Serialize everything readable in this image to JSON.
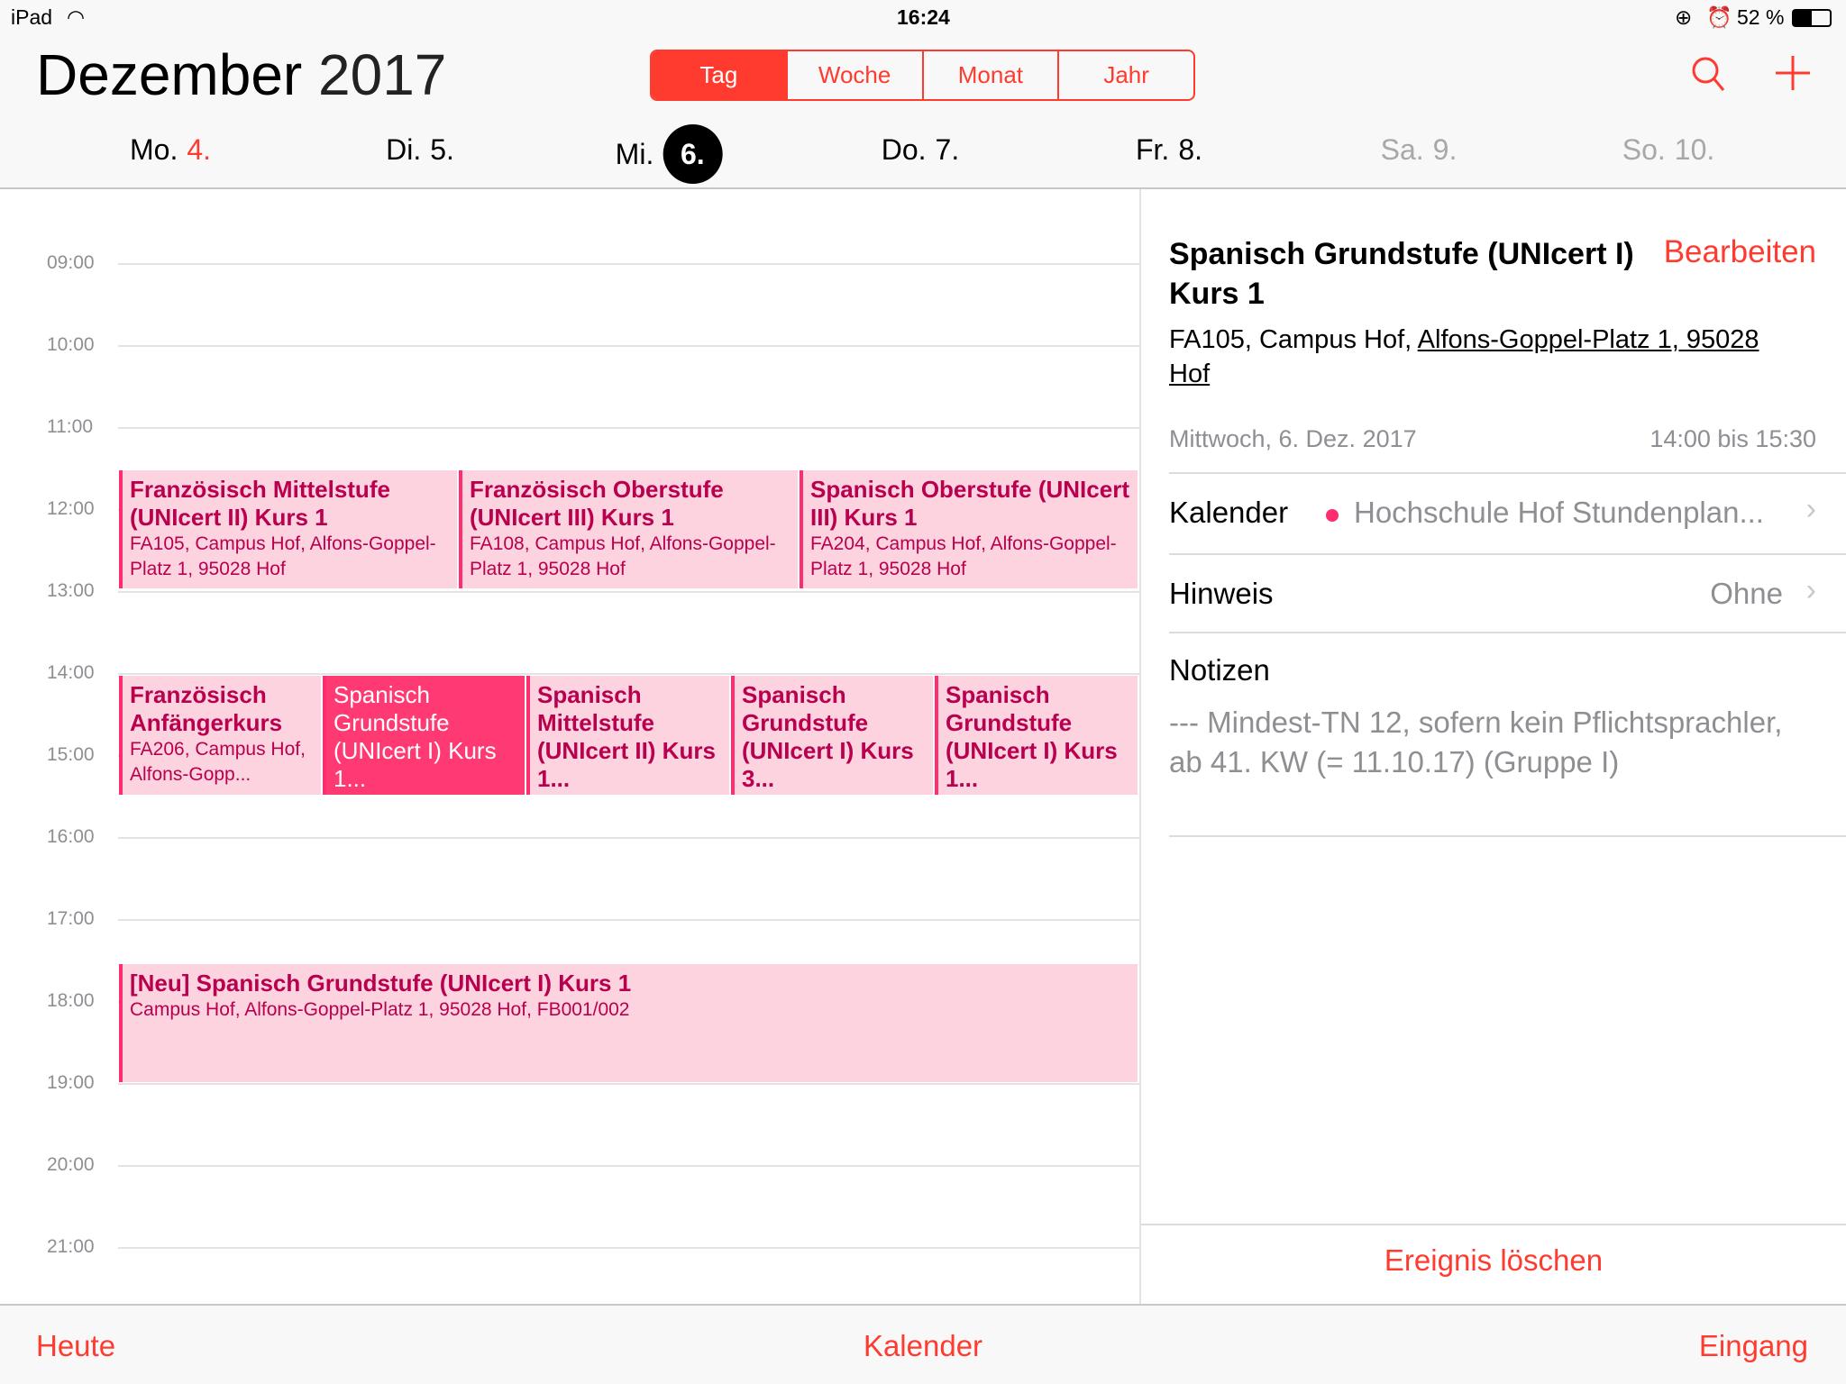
{
  "status": {
    "device": "iPad",
    "time": "16:24",
    "battery": "52 %",
    "battery_level": 52
  },
  "header": {
    "month": "Dezember",
    "year": "2017",
    "views": [
      "Tag",
      "Woche",
      "Monat",
      "Jahr"
    ],
    "selected_view": "Tag",
    "search_icon": "search-icon",
    "add_icon": "plus-icon"
  },
  "days": [
    {
      "wd": "Mo.",
      "d": "4."
    },
    {
      "wd": "Di.",
      "d": "5."
    },
    {
      "wd": "Mi.",
      "d": "6."
    },
    {
      "wd": "Do.",
      "d": "7."
    },
    {
      "wd": "Fr.",
      "d": "8."
    },
    {
      "wd": "Sa.",
      "d": "9."
    },
    {
      "wd": "So.",
      "d": "10."
    }
  ],
  "hours": [
    "09:00",
    "10:00",
    "11:00",
    "12:00",
    "13:00",
    "14:00",
    "15:00",
    "16:00",
    "17:00",
    "18:00",
    "19:00",
    "20:00",
    "21:00"
  ],
  "events": [
    {
      "title": "Französisch Mittelstufe (UNIcert II) Kurs 1",
      "loc": "FA105, Campus Hof, Alfons-Goppel-Platz 1, 95028 Hof"
    },
    {
      "title": "Französisch Oberstufe (UNIcert III) Kurs 1",
      "loc": "FA108, Campus Hof, Alfons-Goppel-Platz 1, 95028 Hof"
    },
    {
      "title": "Spanisch Oberstufe (UNIcert III) Kurs 1",
      "loc": "FA204, Campus Hof, Alfons-Goppel-Platz 1, 95028 Hof"
    },
    {
      "title": "Französisch Anfängerkurs",
      "loc": "FA206, Campus Hof, Alfons-Gopp..."
    },
    {
      "title": "Spanisch Grundstufe (UNIcert I) Kurs 1...",
      "loc": ""
    },
    {
      "title": "Spanisch Mittelstufe (UNIcert II) Kurs 1...",
      "loc": ""
    },
    {
      "title": "Spanisch Grundstufe (UNIcert I) Kurs 3...",
      "loc": ""
    },
    {
      "title": "Spanisch Grundstufe (UNIcert I) Kurs 1...",
      "loc": ""
    },
    {
      "title": "[Neu] Spanisch Grundstufe (UNIcert I) Kurs 1",
      "loc": "Campus Hof, Alfons-Goppel-Platz 1, 95028 Hof, FB001/002"
    }
  ],
  "detail": {
    "title": "Spanisch Grundstufe (UNIcert I) Kurs 1",
    "edit": "Bearbeiten",
    "location_prefix": "FA105, Campus Hof, ",
    "location_link": "Alfons-Goppel-Platz 1, 95028 Hof",
    "date": "Mittwoch, 6. Dez. 2017",
    "time": "14:00 bis 15:30",
    "calendar_label": "Kalender",
    "calendar_value": "Hochschule Hof Stundenplan...",
    "calendar_color": "#ff2d6f",
    "alert_label": "Hinweis",
    "alert_value": "Ohne",
    "notes_label": "Notizen",
    "notes": "---  Mindest-TN 12, sofern kein Pflichtsprachler, ab 41. KW (= 11.10.17) (Gruppe I)",
    "delete": "Ereignis löschen"
  },
  "toolbar": {
    "today": "Heute",
    "calendars": "Kalender",
    "inbox": "Eingang"
  },
  "colors": {
    "accent": "#ff3b30",
    "event_bg": "#fdd3df",
    "event_text": "#b8004e",
    "event_selected": "#ff3a72"
  }
}
